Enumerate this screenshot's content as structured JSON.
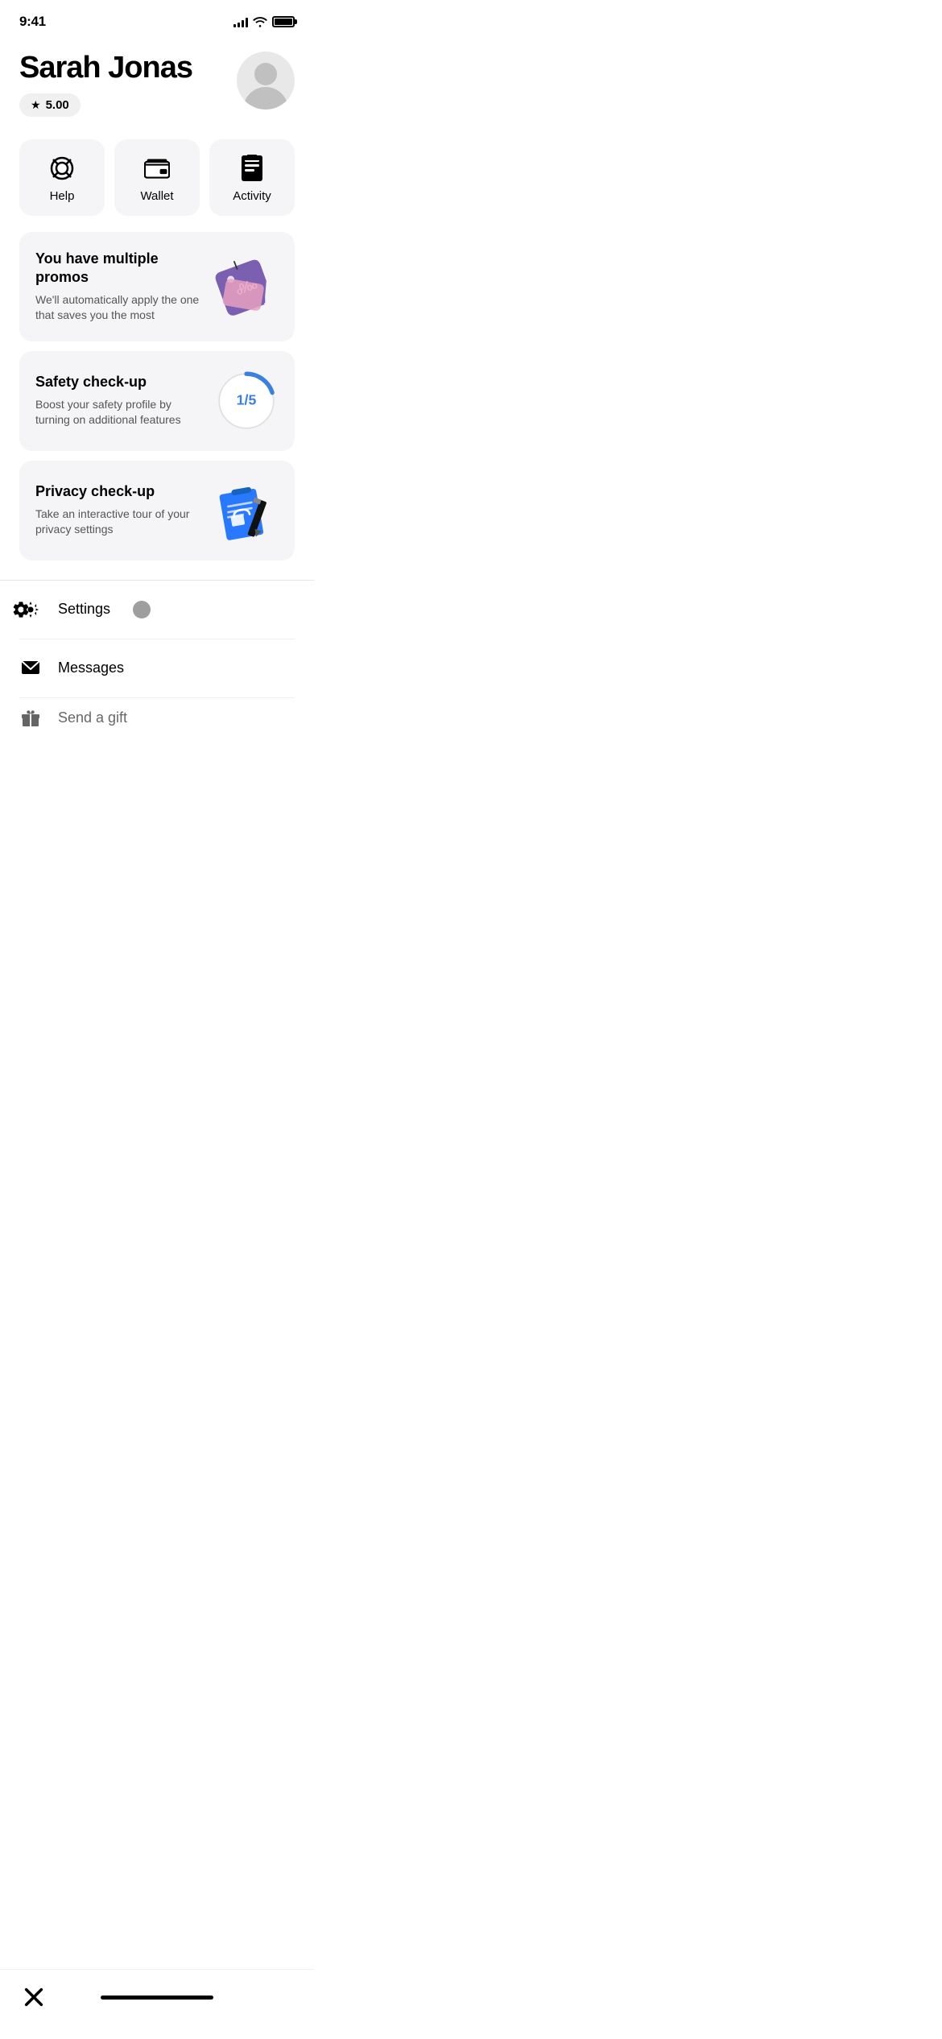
{
  "statusBar": {
    "time": "9:41"
  },
  "header": {
    "userName": "Sarah Jonas",
    "rating": "5.00"
  },
  "quickActions": [
    {
      "id": "help",
      "label": "Help",
      "icon": "help-icon"
    },
    {
      "id": "wallet",
      "label": "Wallet",
      "icon": "wallet-icon"
    },
    {
      "id": "activity",
      "label": "Activity",
      "icon": "activity-icon"
    }
  ],
  "promoCards": [
    {
      "id": "promos",
      "title": "You have multiple promos",
      "subtitle": "We'll automatically apply the one that saves you the most",
      "icon": "promo-tag-icon"
    },
    {
      "id": "safety",
      "title": "Safety check-up",
      "subtitle": "Boost your safety profile by turning on additional features",
      "badge": "1/5",
      "icon": "safety-icon"
    },
    {
      "id": "privacy",
      "title": "Privacy check-up",
      "subtitle": "Take an interactive tour of your privacy settings",
      "icon": "privacy-icon"
    }
  ],
  "menuItems": [
    {
      "id": "settings",
      "label": "Settings",
      "icon": "gear-icon",
      "hasBadge": true
    },
    {
      "id": "messages",
      "label": "Messages",
      "icon": "messages-icon",
      "hasBadge": false
    },
    {
      "id": "send-gift",
      "label": "Send a gift",
      "icon": "gift-icon",
      "hasBadge": false
    }
  ],
  "bottomBar": {
    "closeLabel": "×"
  }
}
